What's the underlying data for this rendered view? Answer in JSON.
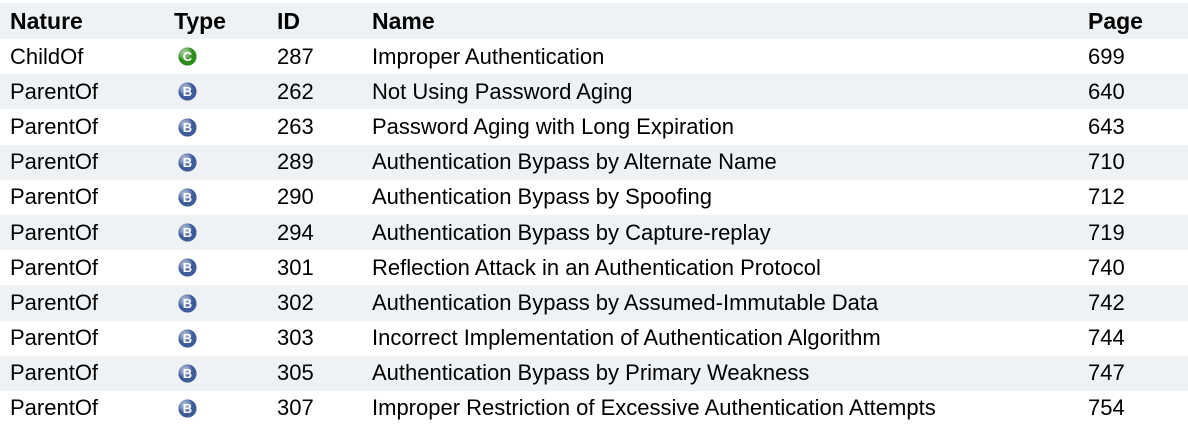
{
  "table": {
    "headers": {
      "nature": "Nature",
      "type": "Type",
      "id": "ID",
      "name": "Name",
      "page": "Page"
    },
    "type_colors": {
      "C": "#2e8b1e",
      "B": "#3f5c9a"
    },
    "rows": [
      {
        "nature": "ChildOf",
        "type": "C",
        "type_icon": "category-icon",
        "id": "287",
        "name": "Improper Authentication",
        "page": "699"
      },
      {
        "nature": "ParentOf",
        "type": "B",
        "type_icon": "base-icon",
        "id": "262",
        "name": "Not Using Password Aging",
        "page": "640"
      },
      {
        "nature": "ParentOf",
        "type": "B",
        "type_icon": "base-icon",
        "id": "263",
        "name": "Password Aging with Long Expiration",
        "page": "643"
      },
      {
        "nature": "ParentOf",
        "type": "B",
        "type_icon": "base-icon",
        "id": "289",
        "name": "Authentication Bypass by Alternate Name",
        "page": "710"
      },
      {
        "nature": "ParentOf",
        "type": "B",
        "type_icon": "base-icon",
        "id": "290",
        "name": "Authentication Bypass by Spoofing",
        "page": "712"
      },
      {
        "nature": "ParentOf",
        "type": "B",
        "type_icon": "base-icon",
        "id": "294",
        "name": "Authentication Bypass by Capture-replay",
        "page": "719"
      },
      {
        "nature": "ParentOf",
        "type": "B",
        "type_icon": "base-icon",
        "id": "301",
        "name": "Reflection Attack in an Authentication Protocol",
        "page": "740"
      },
      {
        "nature": "ParentOf",
        "type": "B",
        "type_icon": "base-icon",
        "id": "302",
        "name": "Authentication Bypass by Assumed-Immutable Data",
        "page": "742"
      },
      {
        "nature": "ParentOf",
        "type": "B",
        "type_icon": "base-icon",
        "id": "303",
        "name": "Incorrect Implementation of Authentication Algorithm",
        "page": "744"
      },
      {
        "nature": "ParentOf",
        "type": "B",
        "type_icon": "base-icon",
        "id": "305",
        "name": "Authentication Bypass by Primary Weakness",
        "page": "747"
      },
      {
        "nature": "ParentOf",
        "type": "B",
        "type_icon": "base-icon",
        "id": "307",
        "name": "Improper Restriction of Excessive Authentication Attempts",
        "page": "754"
      }
    ]
  }
}
